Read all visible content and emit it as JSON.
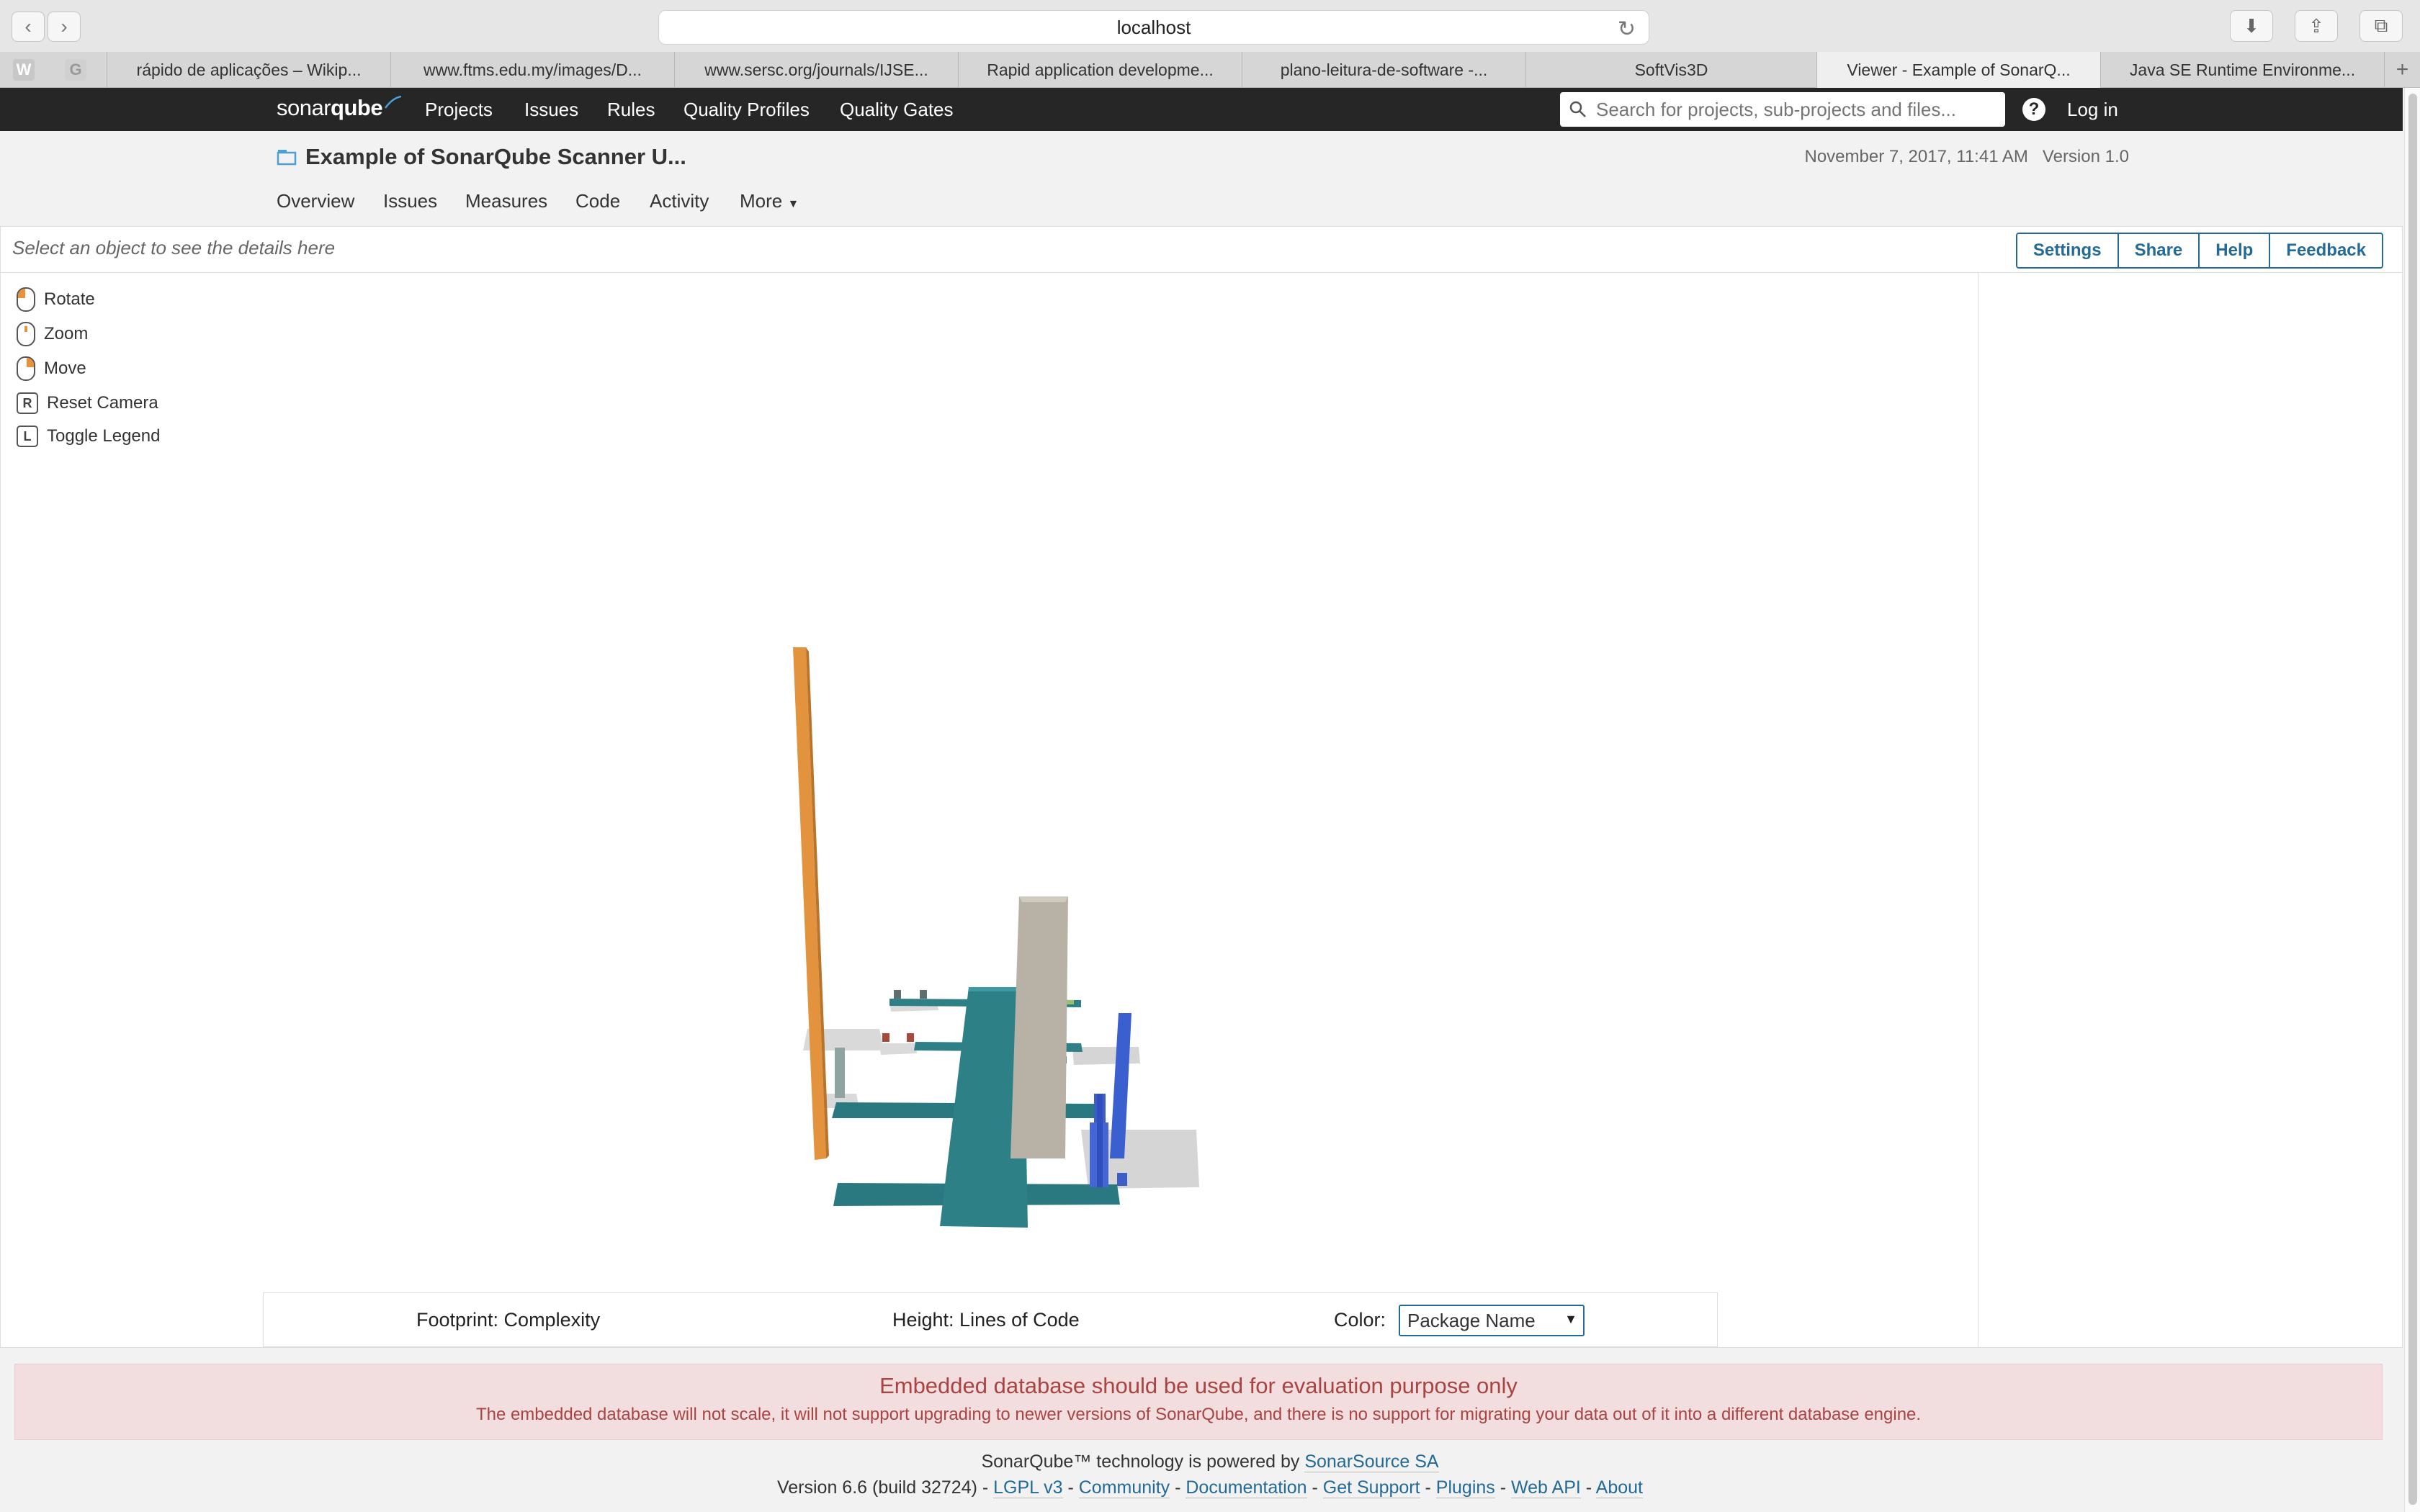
{
  "browser": {
    "url": "localhost",
    "tabs": [
      {
        "label": "rápido de aplicações – Wikip...",
        "active": false
      },
      {
        "label": "www.ftms.edu.my/images/D...",
        "active": false
      },
      {
        "label": "www.sersc.org/journals/IJSE...",
        "active": false
      },
      {
        "label": "Rapid application developme...",
        "active": false
      },
      {
        "label": "plano-leitura-de-software -...",
        "active": false
      },
      {
        "label": "SoftVis3D",
        "active": false
      },
      {
        "label": "Viewer - Example of SonarQ...",
        "active": true
      },
      {
        "label": "Java SE Runtime Environme...",
        "active": false
      }
    ]
  },
  "nav": {
    "logo_a": "sonar",
    "logo_b": "qube",
    "links": [
      "Projects",
      "Issues",
      "Rules",
      "Quality Profiles",
      "Quality Gates"
    ],
    "search_placeholder": "Search for projects, sub-projects and files...",
    "login": "Log in"
  },
  "project": {
    "title": "Example of SonarQube Scanner U...",
    "date": "November 7, 2017, 11:41 AM",
    "version": "Version 1.0",
    "tabs": [
      "Overview",
      "Issues",
      "Measures",
      "Code",
      "Activity",
      "More"
    ]
  },
  "viewer": {
    "details_hint": "Select an object to see the details here",
    "buttons": [
      "Settings",
      "Share",
      "Help",
      "Feedback"
    ],
    "controls": [
      {
        "label": "Rotate",
        "key": ""
      },
      {
        "label": "Zoom",
        "key": ""
      },
      {
        "label": "Move",
        "key": ""
      },
      {
        "label": "Reset Camera",
        "key": "R"
      },
      {
        "label": "Toggle Legend",
        "key": "L"
      }
    ],
    "footprint": "Footprint: Complexity",
    "height": "Height: Lines of Code",
    "color_label": "Color:",
    "color_value": "Package Name"
  },
  "warning": {
    "title": "Embedded database should be used for evaluation purpose only",
    "text": "The embedded database will not scale, it will not support upgrading to newer versions of SonarQube, and there is no support for migrating your data out of it into a different database engine."
  },
  "footer": {
    "line1_prefix": "SonarQube™ technology is powered by ",
    "line1_link": "SonarSource SA",
    "version": "Version 6.6 (build 32724)",
    "links": [
      "LGPL v3",
      "Community",
      "Documentation",
      "Get Support",
      "Plugins",
      "Web API",
      "About"
    ]
  }
}
